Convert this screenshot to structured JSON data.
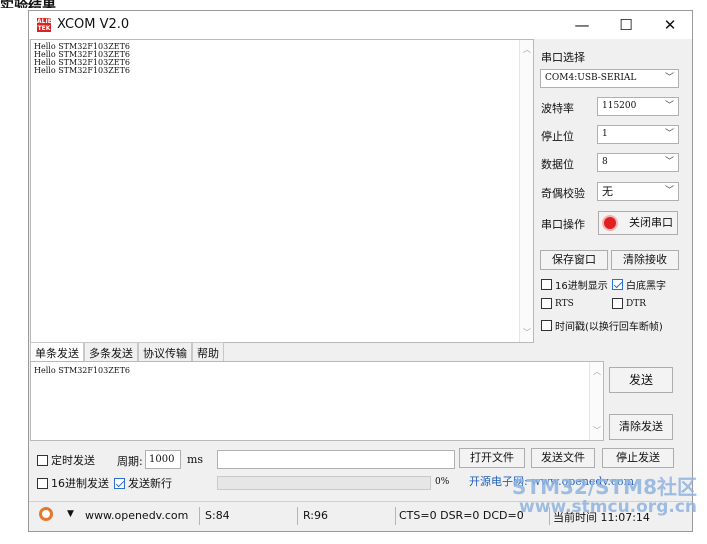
{
  "heading": "实验结果",
  "window": {
    "icon_text": "ALIENTEK",
    "title": "XCOM V2.0",
    "minimize": "—",
    "maximize": "☐",
    "close": "✕"
  },
  "receive": {
    "text": "Hello STM32F103ZET6\nHello STM32F103ZET6\nHello STM32F103ZET6\nHello STM32F103ZET6"
  },
  "right_panel": {
    "port_label": "串口选择",
    "port_value": "COM4:USB-SERIAL",
    "baud_label": "波特率",
    "baud_value": "115200",
    "stop_label": "停止位",
    "stop_value": "1",
    "data_label": "数据位",
    "data_value": "8",
    "parity_label": "奇偶校验",
    "parity_value": "无",
    "op_label": "串口操作",
    "op_button": "关闭串口",
    "save_window": "保存窗口",
    "clear_receive": "清除接收",
    "hex_display": "16进制显示",
    "white_bg": "白底黑字",
    "rts": "RTS",
    "dtr": "DTR",
    "timestamp": "时间戳(以换行回车断帧)"
  },
  "tabs": [
    "单条发送",
    "多条发送",
    "协议传输",
    "帮助"
  ],
  "send": {
    "text": "Hello STM32F103ZET6",
    "send_button": "发送",
    "clear_send": "清除发送",
    "timed_send": "定时发送",
    "period_label": "周期:",
    "period_value": "1000",
    "period_unit": "ms",
    "open_file": "打开文件",
    "send_file": "发送文件",
    "stop_send": "停止发送",
    "hex_send": "16进制发送",
    "send_newline": "发送新行",
    "progress": "0%",
    "ad_text": "开源电子网: www.openedv.com"
  },
  "status": {
    "url": "www.openedv.com",
    "sent": "S:84",
    "received": "R:96",
    "signals": "CTS=0 DSR=0 DCD=0",
    "time": "当前时间 11:07:14"
  },
  "watermark": {
    "line1": "STM32/STM8社区",
    "line2": "www.stmcu.org.cn"
  },
  "colors": {
    "accent": "#2b6fd1",
    "close_icon": "#e02020",
    "ad_text": "#2060c0"
  }
}
